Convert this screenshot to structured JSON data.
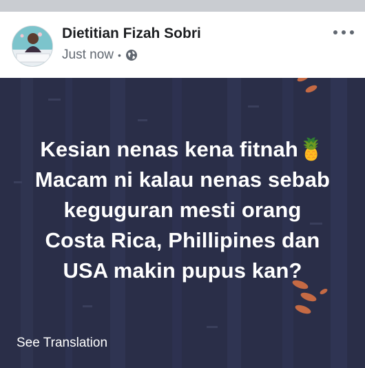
{
  "post": {
    "author": "Dietitian Fizah Sobri",
    "timestamp": "Just now",
    "separator": "•",
    "privacy_icon": "globe-icon",
    "more_icon": "more-options-icon",
    "lines": [
      "Kesian nenas kena fitnah🍍",
      "Macam ni kalau nenas sebab",
      "keguguran mesti orang",
      "Costa Rica, Phillipines dan",
      "USA makin pupus kan?"
    ],
    "see_translation": "See Translation"
  },
  "colors": {
    "background_post": "#2a2e48",
    "header_bg": "#ffffff",
    "meta_text": "#606770",
    "author_text": "#1c1e21"
  }
}
